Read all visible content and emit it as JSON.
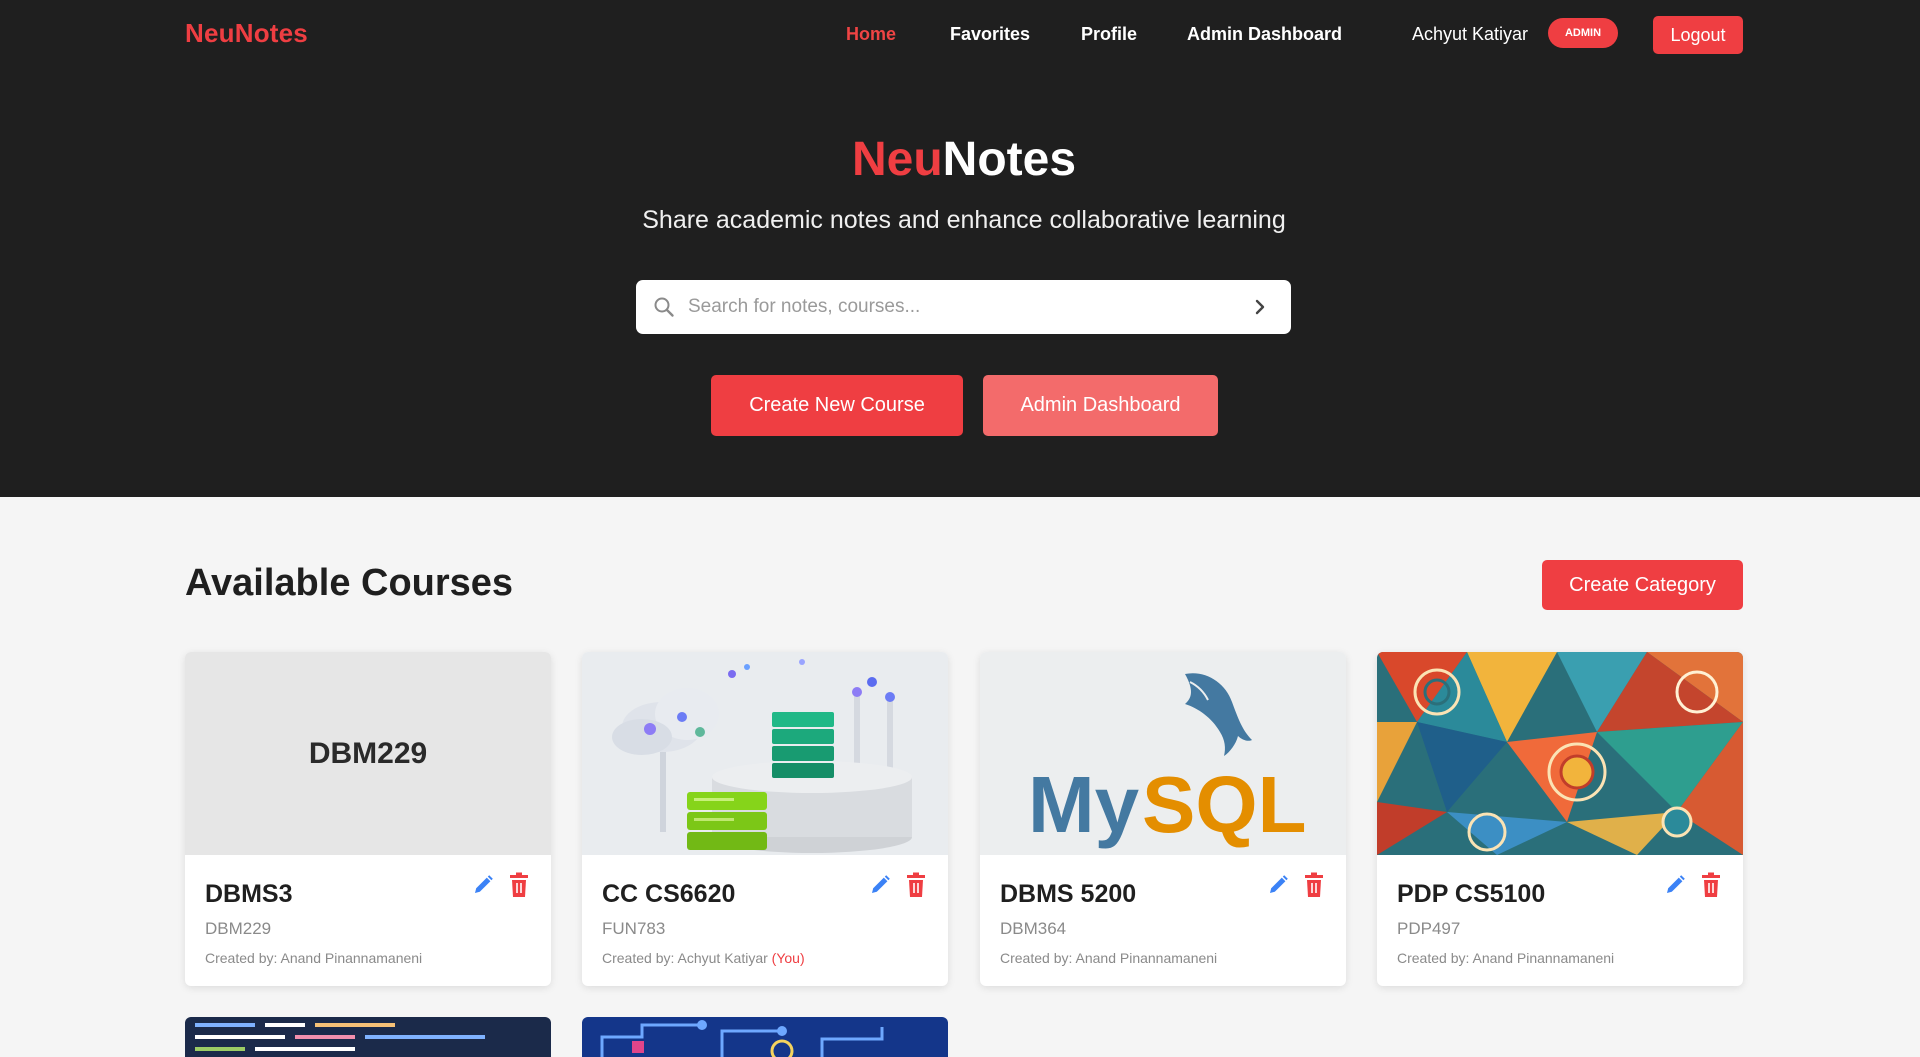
{
  "nav": {
    "brand": "NeuNotes",
    "links": [
      "Home",
      "Favorites",
      "Profile",
      "Admin Dashboard"
    ],
    "active": "Home",
    "user_name": "Achyut Katiyar",
    "role_badge": "ADMIN",
    "logout_label": "Logout"
  },
  "hero": {
    "title_part1": "Neu",
    "title_part2": "Notes",
    "subtitle": "Share academic notes and enhance collaborative learning",
    "search_placeholder": "Search for notes, courses...",
    "create_course_label": "Create New Course",
    "admin_dashboard_label": "Admin Dashboard"
  },
  "courses": {
    "section_title": "Available Courses",
    "create_category_label": "Create Category",
    "created_by_prefix": "Created by: ",
    "you_marker": "(You)",
    "cards": [
      {
        "title": "DBMS3",
        "code": "DBM229",
        "creator": "Anand Pinannamaneni",
        "image": "placeholder",
        "image_text": "DBM229"
      },
      {
        "title": "CC CS6620",
        "code": "FUN783",
        "creator": "Achyut Katiyar",
        "image": "cloud-servers-illustration"
      },
      {
        "title": "DBMS 5200",
        "code": "DBM364",
        "creator": "Anand Pinannamaneni",
        "image": "mysql-logo",
        "logo_text_1": "My",
        "logo_text_2": "SQL"
      },
      {
        "title": "PDP CS5100",
        "code": "PDP497",
        "creator": "Anand Pinannamaneni",
        "image": "colorful-mosaic-pattern"
      }
    ]
  },
  "colors": {
    "accent": "#ef3e42",
    "accent_light": "#f36b6b",
    "hero_bg": "#1f1f1f",
    "page_bg": "#f5f5f5",
    "mysql_blue": "#4479a1",
    "mysql_orange": "#e48e00"
  },
  "icons": [
    "search-icon",
    "chevron-right-icon",
    "pencil-icon",
    "trash-icon"
  ]
}
